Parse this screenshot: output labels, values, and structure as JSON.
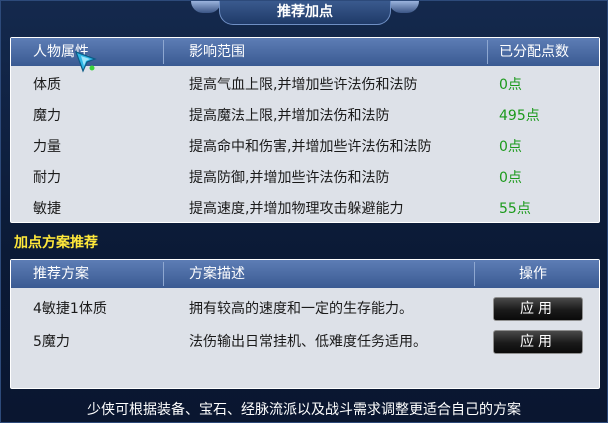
{
  "window": {
    "title": "推荐加点"
  },
  "attributes": {
    "headers": [
      "人物属性",
      "影响范围",
      "已分配点数"
    ],
    "rows": [
      {
        "name": "体质",
        "effect": "提高气血上限,并增加些许法伤和法防",
        "points": "0点"
      },
      {
        "name": "魔力",
        "effect": "提高魔法上限,并增加法伤和法防",
        "points": "495点"
      },
      {
        "name": "力量",
        "effect": "提高命中和伤害,并增加些许法伤和法防",
        "points": "0点"
      },
      {
        "name": "耐力",
        "effect": "提高防御,并增加些许法伤和法防",
        "points": "0点"
      },
      {
        "name": "敏捷",
        "effect": "提高速度,并增加物理攻击躲避能力",
        "points": "55点"
      }
    ]
  },
  "plans": {
    "section_label": "加点方案推荐",
    "headers": [
      "推荐方案",
      "方案描述",
      "操作"
    ],
    "rows": [
      {
        "name": "4敏捷1体质",
        "desc": "拥有较高的速度和一定的生存能力。",
        "action": "应用"
      },
      {
        "name": "5魔力",
        "desc": "法伤输出日常挂机、低难度任务适用。",
        "action": "应用"
      }
    ]
  },
  "footer": "少侠可根据装备、宝石、经脉流派以及战斗需求调整更适合自己的方案",
  "icons": {
    "cursor": "wand-cursor-icon"
  },
  "colors": {
    "points_value": "#1c9a1c",
    "section_label": "#ffe83a",
    "header_bg": "#4a6aa3"
  }
}
